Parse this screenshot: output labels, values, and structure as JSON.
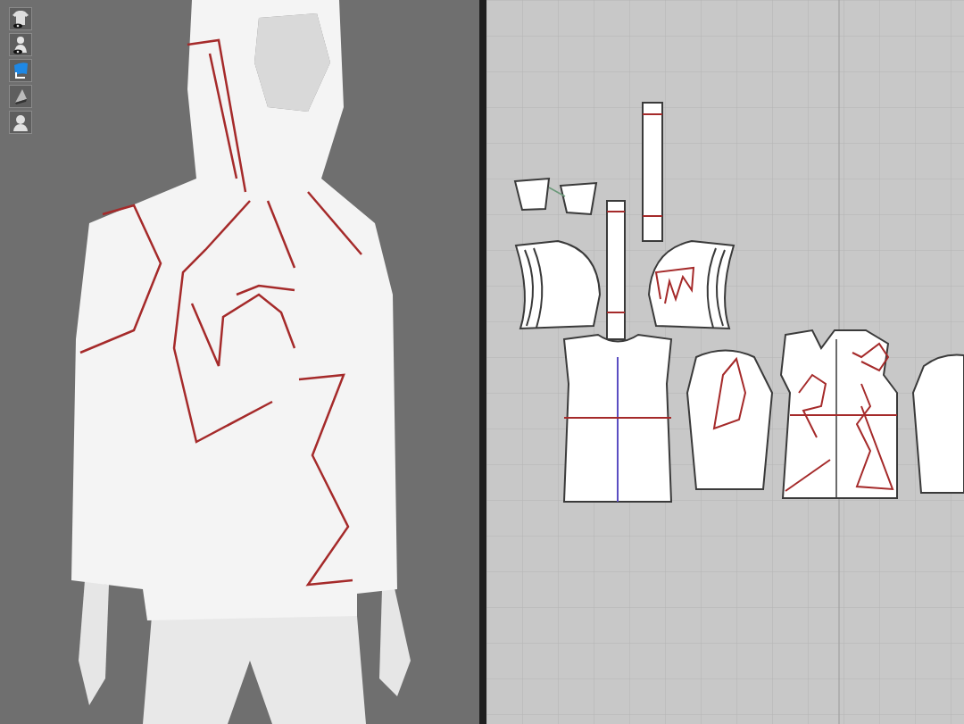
{
  "viewport_3d": {
    "toolbar": [
      {
        "kind": "garment-visibility"
      },
      {
        "kind": "avatar-visibility"
      },
      {
        "kind": "texture"
      },
      {
        "kind": "shading"
      },
      {
        "kind": "avatar"
      }
    ]
  }
}
